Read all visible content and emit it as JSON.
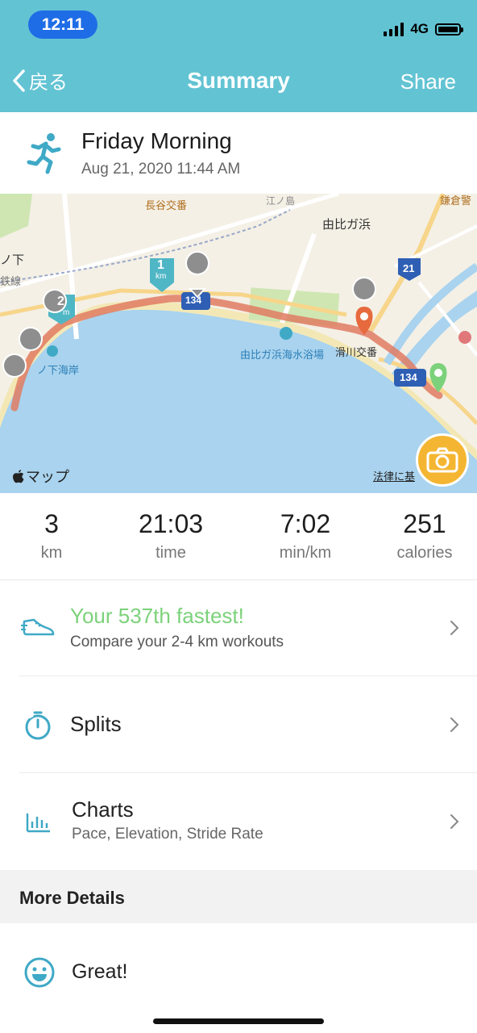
{
  "status": {
    "time": "12:11",
    "network": "4G"
  },
  "nav": {
    "back_label": "戻る",
    "title": "Summary",
    "share_label": "Share"
  },
  "activity": {
    "title": "Friday Morning",
    "date": "Aug 21, 2020 11:44 AM",
    "icon": "runner-icon"
  },
  "map": {
    "labels": {
      "hase": "長谷交番",
      "yuigahama": "由比ガ浜",
      "kamakura_police": "鎌倉警",
      "noshita": "ノ下",
      "tetsudo": "鉄線",
      "beach_left": "ノ下海岸",
      "yuigahama_beach": "由比ガ浜海水浴場",
      "namerikawa": "滑川交番",
      "enoden": "江ノ島",
      "route_21": "21",
      "route_134a": "134",
      "route_134b": "134",
      "km1": "1",
      "km1_unit": "km",
      "km2": "2",
      "km2_unit": "m"
    },
    "attribution": "マップ",
    "legal": "法律に基",
    "route_color": "#e07b61",
    "camera_icon": "camera-icon"
  },
  "stats": [
    {
      "value": "3",
      "unit": "km"
    },
    {
      "value": "21:03",
      "unit": "time"
    },
    {
      "value": "7:02",
      "unit": "min/km"
    },
    {
      "value": "251",
      "unit": "calories"
    }
  ],
  "fastest": {
    "title": "Your 537th fastest!",
    "subtitle": "Compare your 2-4 km workouts",
    "accent": "#7cd27b"
  },
  "splits": {
    "label": "Splits"
  },
  "charts": {
    "label": "Charts",
    "subtitle": "Pace, Elevation, Stride Rate"
  },
  "more_details": {
    "label": "More Details"
  },
  "feeling": {
    "label": "Great!"
  },
  "colors": {
    "header": "#62c3d3",
    "accent_blue": "#3fa9c6",
    "camera": "#f4b632"
  }
}
